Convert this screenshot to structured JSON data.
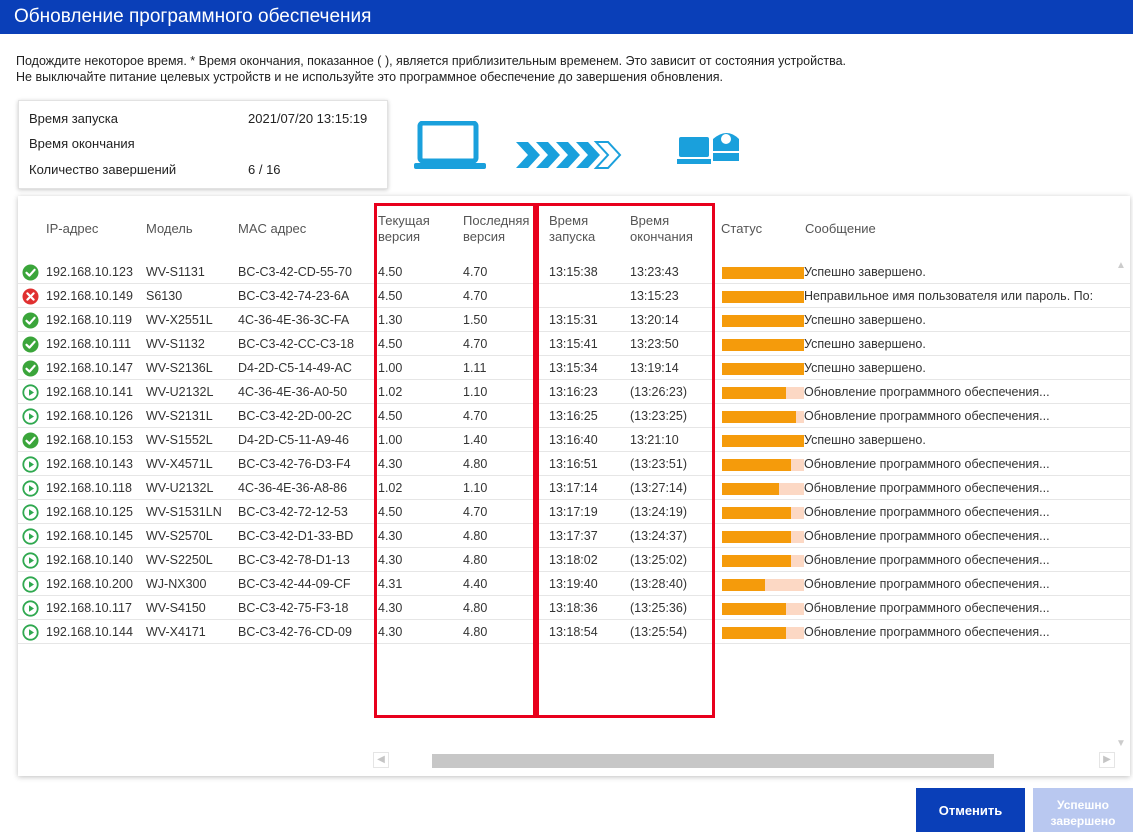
{
  "window": {
    "title": "Обновление программного обеспечения"
  },
  "notice": {
    "line1": "Подождите некоторое время.  * Время окончания, показанное ( ), является приблизительным временем. Это зависит от состояния устройства.",
    "line2": "Не выключайте питание целевых устройств и не используйте это программное обеспечение до завершения обновления."
  },
  "summary": {
    "start_label": "Время запуска",
    "start_value": "2021/07/20 13:15:19",
    "end_label": "Время окончания",
    "end_value": "",
    "count_label": "Количество завершений",
    "count_value": "6 / 16"
  },
  "icons": {
    "source": "laptop-icon",
    "transfer": "arrows-icon",
    "target": "camera-icon"
  },
  "colors": {
    "accent": "#0a3fb8",
    "progress": "#f59b0b",
    "progress_bg": "#fcd8c4",
    "ok": "#3aa53a",
    "error": "#e03030",
    "running": "#2fa84f",
    "highlight": "#e8001c"
  },
  "table": {
    "headers": {
      "ip": "IP-адрес",
      "model": "Модель",
      "mac": "MAC адрес",
      "current_l1": "Текущая",
      "current_l2": "версия",
      "latest_l1": "Последняя",
      "latest_l2": "версия",
      "start_l1": "Время",
      "start_l2": "запуска",
      "end_l1": "Время",
      "end_l2": "окончания",
      "status": "Статус",
      "message": "Сообщение"
    },
    "rows": [
      {
        "state": "ok",
        "ip": "192.168.10.123",
        "model": "WV-S1131",
        "mac": "BC-C3-42-CD-55-70",
        "cur": "4.50",
        "new": "4.70",
        "start": "13:15:38",
        "end": "13:23:43",
        "progress": 1.0,
        "message": "Успешно завершено."
      },
      {
        "state": "error",
        "ip": "192.168.10.149",
        "model": "S6130",
        "mac": "BC-C3-42-74-23-6A",
        "cur": "4.50",
        "new": "4.70",
        "start": "",
        "end": "13:15:23",
        "progress": 1.0,
        "message": "Неправильное имя пользователя или пароль. По:"
      },
      {
        "state": "ok",
        "ip": "192.168.10.119",
        "model": "WV-X2551L",
        "mac": "4C-36-4E-36-3C-FA",
        "cur": "1.30",
        "new": "1.50",
        "start": "13:15:31",
        "end": "13:20:14",
        "progress": 1.0,
        "message": "Успешно завершено."
      },
      {
        "state": "ok",
        "ip": "192.168.10.111",
        "model": "WV-S1132",
        "mac": "BC-C3-42-CC-C3-18",
        "cur": "4.50",
        "new": "4.70",
        "start": "13:15:41",
        "end": "13:23:50",
        "progress": 1.0,
        "message": "Успешно завершено."
      },
      {
        "state": "ok",
        "ip": "192.168.10.147",
        "model": "WV-S2136L",
        "mac": "D4-2D-C5-14-49-AC",
        "cur": "1.00",
        "new": "1.11",
        "start": "13:15:34",
        "end": "13:19:14",
        "progress": 1.0,
        "message": "Успешно завершено."
      },
      {
        "state": "running",
        "ip": "192.168.10.141",
        "model": "WV-U2132L",
        "mac": "4C-36-4E-36-A0-50",
        "cur": "1.02",
        "new": "1.10",
        "start": "13:16:23",
        "end": "(13:26:23)",
        "progress": 0.78,
        "message": "Обновление программного обеспечения..."
      },
      {
        "state": "running",
        "ip": "192.168.10.126",
        "model": "WV-S2131L",
        "mac": "BC-C3-42-2D-00-2C",
        "cur": "4.50",
        "new": "4.70",
        "start": "13:16:25",
        "end": "(13:23:25)",
        "progress": 0.9,
        "message": "Обновление программного обеспечения..."
      },
      {
        "state": "ok",
        "ip": "192.168.10.153",
        "model": "WV-S1552L",
        "mac": "D4-2D-C5-11-A9-46",
        "cur": "1.00",
        "new": "1.40",
        "start": "13:16:40",
        "end": "13:21:10",
        "progress": 1.0,
        "message": "Успешно завершено."
      },
      {
        "state": "running",
        "ip": "192.168.10.143",
        "model": "WV-X4571L",
        "mac": "BC-C3-42-76-D3-F4",
        "cur": "4.30",
        "new": "4.80",
        "start": "13:16:51",
        "end": "(13:23:51)",
        "progress": 0.84,
        "message": "Обновление программного обеспечения..."
      },
      {
        "state": "running",
        "ip": "192.168.10.118",
        "model": "WV-U2132L",
        "mac": "4C-36-4E-36-A8-86",
        "cur": "1.02",
        "new": "1.10",
        "start": "13:17:14",
        "end": "(13:27:14)",
        "progress": 0.7,
        "message": "Обновление программного обеспечения..."
      },
      {
        "state": "running",
        "ip": "192.168.10.125",
        "model": "WV-S1531LN",
        "mac": "BC-C3-42-72-12-53",
        "cur": "4.50",
        "new": "4.70",
        "start": "13:17:19",
        "end": "(13:24:19)",
        "progress": 0.84,
        "message": "Обновление программного обеспечения..."
      },
      {
        "state": "running",
        "ip": "192.168.10.145",
        "model": "WV-S2570L",
        "mac": "BC-C3-42-D1-33-BD",
        "cur": "4.30",
        "new": "4.80",
        "start": "13:17:37",
        "end": "(13:24:37)",
        "progress": 0.84,
        "message": "Обновление программного обеспечения..."
      },
      {
        "state": "running",
        "ip": "192.168.10.140",
        "model": "WV-S2250L",
        "mac": "BC-C3-42-78-D1-13",
        "cur": "4.30",
        "new": "4.80",
        "start": "13:18:02",
        "end": "(13:25:02)",
        "progress": 0.84,
        "message": "Обновление программного обеспечения..."
      },
      {
        "state": "running",
        "ip": "192.168.10.200",
        "model": "WJ-NX300",
        "mac": "BC-C3-42-44-09-CF",
        "cur": "4.31",
        "new": "4.40",
        "start": "13:19:40",
        "end": "(13:28:40)",
        "progress": 0.52,
        "message": "Обновление программного обеспечения..."
      },
      {
        "state": "running",
        "ip": "192.168.10.117",
        "model": "WV-S4150",
        "mac": "BC-C3-42-75-F3-18",
        "cur": "4.30",
        "new": "4.80",
        "start": "13:18:36",
        "end": "(13:25:36)",
        "progress": 0.78,
        "message": "Обновление программного обеспечения..."
      },
      {
        "state": "running",
        "ip": "192.168.10.144",
        "model": "WV-X4171",
        "mac": "BC-C3-42-76-CD-09",
        "cur": "4.30",
        "new": "4.80",
        "start": "13:18:54",
        "end": "(13:25:54)",
        "progress": 0.78,
        "message": "Обновление программного обеспечения..."
      }
    ]
  },
  "buttons": {
    "cancel": "Отменить",
    "done_l1": "Успешно",
    "done_l2": "завершено"
  }
}
